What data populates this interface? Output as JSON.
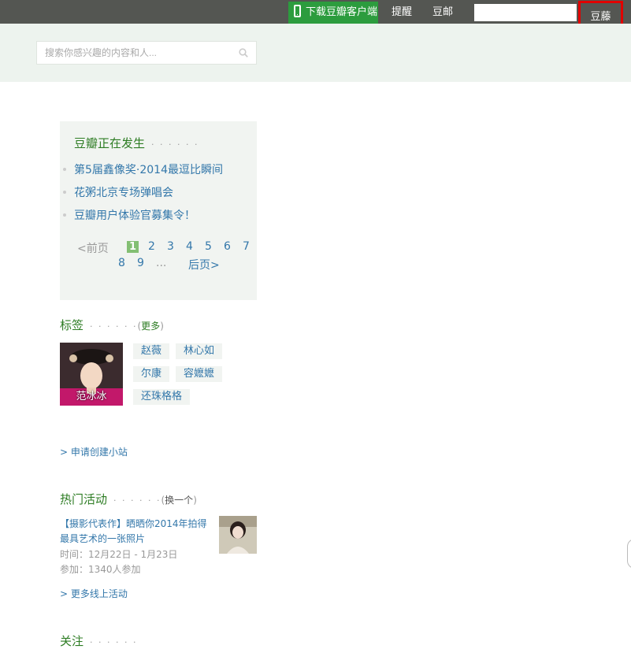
{
  "topbar": {
    "download_app": "下载豆瓣客户端",
    "reminders": "提醒",
    "mail": "豆邮",
    "search_value": "",
    "username": "豆藤"
  },
  "search": {
    "placeholder": "搜索你感兴趣的内容和人..."
  },
  "happening": {
    "title": "豆瓣正在发生",
    "dots": "· · · · · ·",
    "items": [
      "第5届鑫像奖·2014最逗比瞬间",
      "花粥北京专场弹唱会",
      "豆瓣用户体验官募集令！"
    ],
    "pager": {
      "prev": "<前页",
      "pages": [
        "1",
        "2",
        "3",
        "4",
        "5",
        "6",
        "7",
        "8",
        "9"
      ],
      "ellipsis": "...",
      "next": "后页>",
      "current": "1"
    }
  },
  "tags": {
    "title": "标签",
    "dots": "· · · · · ·",
    "more_open": "(",
    "more": "更多",
    "more_close": ")",
    "avatar_caption": "范冰冰",
    "items": [
      "赵薇",
      "林心如",
      "尔康",
      "容嬷嬷",
      "还珠格格"
    ]
  },
  "apply_site": "> 申请创建小站",
  "hot_events": {
    "title": "热门活动",
    "dots": "· · · · · ·",
    "refresh_open": "(",
    "refresh": "换一个",
    "refresh_close": ")",
    "event": {
      "title": "【摄影代表作】晒晒你2014年拍得最具艺术的一张照片",
      "time": "时间：12月22日 - 1月23日",
      "join": "参加：1340人参加"
    },
    "more_online": "> 更多线上活动"
  },
  "follow": {
    "title": "关注",
    "dots": "· · · · · ·"
  },
  "colors": {
    "topbar": "#545652",
    "download": "#2c9c3e",
    "header": "#edf3ee",
    "accent": "#2d7c23",
    "link": "#3377aa",
    "highlight": "#e10000"
  }
}
